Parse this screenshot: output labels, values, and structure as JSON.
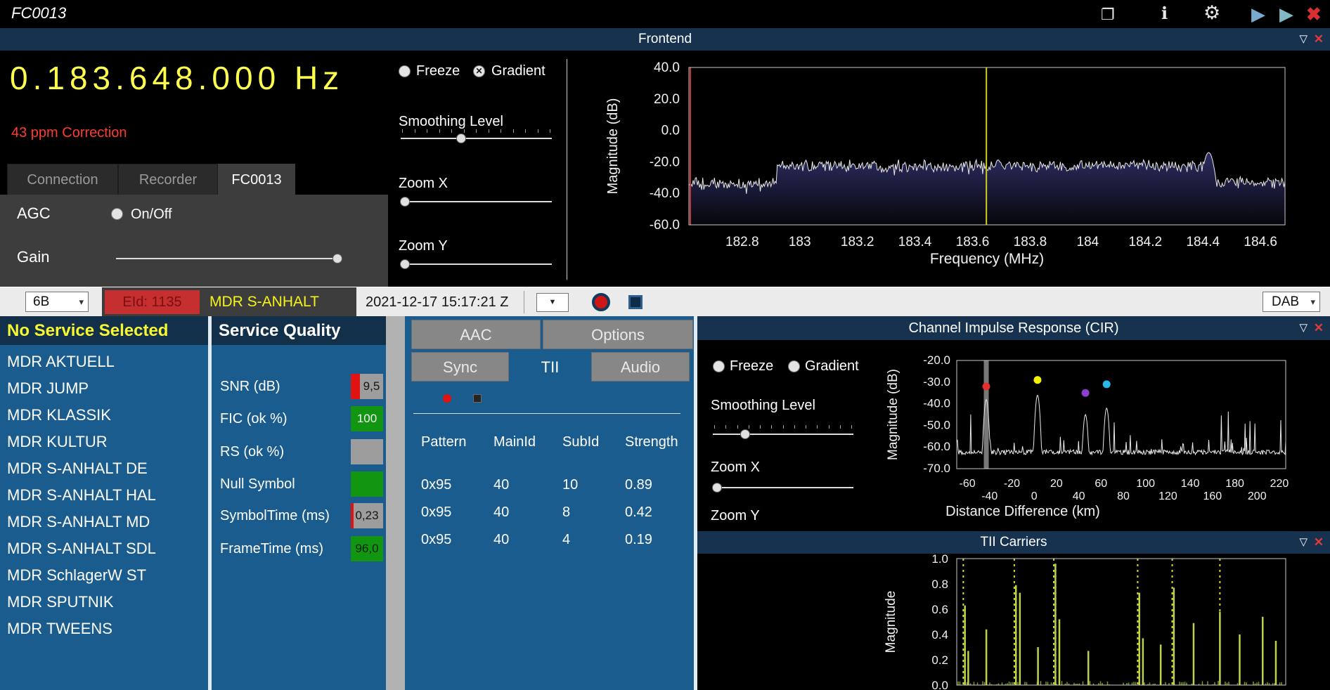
{
  "icons": {
    "window": "❐",
    "info": "ℹ",
    "settings": "⚙",
    "play": "▶",
    "close": "✖",
    "collapse": "▽",
    "panel_close": "✕",
    "dropdown": "▼",
    "select_arrow": "▾"
  },
  "titlebar": {
    "title": "FC0013"
  },
  "frontend": {
    "title": "Frontend",
    "frequency": "0.183.648.000 Hz",
    "correction": "43 ppm Correction",
    "tabs": [
      {
        "label": "Connection",
        "active": false
      },
      {
        "label": "Recorder",
        "active": false
      },
      {
        "label": "FC0013",
        "active": true
      }
    ],
    "agc_label": "AGC",
    "agc_toggle_label": "On/Off",
    "gain_label": "Gain",
    "freeze_label": "Freeze",
    "gradient_label": "Gradient",
    "smoothing_label": "Smoothing Level",
    "zoom_x_label": "Zoom X",
    "zoom_y_label": "Zoom Y"
  },
  "toolbar": {
    "channel": "6B",
    "eid": "EId: 1135",
    "ensemble": "MDR S-ANHALT",
    "timestamp": "2021-12-17  15:17:21 Z",
    "mode": "DAB"
  },
  "services": {
    "header": "No Service Selected",
    "items": [
      "MDR AKTUELL",
      "MDR JUMP",
      "MDR KLASSIK",
      "MDR KULTUR",
      "MDR S-ANHALT DE",
      "MDR S-ANHALT HAL",
      "MDR S-ANHALT MD",
      "MDR S-ANHALT SDL",
      "MDR SchlagerW ST",
      "MDR SPUTNIK",
      "MDR TWEENS"
    ]
  },
  "service_quality": {
    "title": "Service Quality",
    "rows": [
      {
        "label": "SNR (dB)",
        "value": "9,5",
        "box": "gray-redbar"
      },
      {
        "label": "FIC (ok %)",
        "value": "100",
        "box": "green"
      },
      {
        "label": "RS (ok %)",
        "value": "",
        "box": "gray"
      },
      {
        "label": "Null Symbol",
        "value": "",
        "box": "green"
      },
      {
        "label": "SymbolTime (ms)",
        "value": "0,23",
        "box": "gray-redsliver"
      },
      {
        "label": "FrameTime (ms)",
        "value": "96,0",
        "box": "green-dark"
      }
    ]
  },
  "details": {
    "tabs_top": [
      {
        "label": "AAC",
        "active": false
      },
      {
        "label": "Options",
        "active": false
      }
    ],
    "tabs_bottom": [
      {
        "label": "Sync",
        "active": false
      },
      {
        "label": "TII",
        "active": true
      },
      {
        "label": "Audio",
        "active": false
      }
    ],
    "tii_table": {
      "headers": [
        "Pattern",
        "MainId",
        "SubId",
        "Strength"
      ],
      "rows": [
        [
          "0x95",
          "40",
          "10",
          "0.89"
        ],
        [
          "0x95",
          "40",
          "8",
          "0.42"
        ],
        [
          "0x95",
          "40",
          "4",
          "0.19"
        ]
      ]
    }
  },
  "cir": {
    "title": "Channel Impulse Response (CIR)",
    "freeze_label": "Freeze",
    "gradient_label": "Gradient",
    "smoothing_label": "Smoothing Level",
    "zoom_x_label": "Zoom X",
    "zoom_y_label": "Zoom Y"
  },
  "tii_panel": {
    "title": "TII Carriers"
  },
  "colors": {
    "panel_blue": "#1b5c8e",
    "header_navy": "#16324e",
    "list_header_navy": "#12304a",
    "frequency_yellow": "#ffff4d",
    "warning_red": "#ff3b2d",
    "eid_red": "#c62f2f",
    "status_green": "#129612",
    "status_gray": "#9d9d9d",
    "status_red": "#e01212"
  },
  "chart_data": [
    {
      "id": "spectrum",
      "type": "line",
      "xlabel": "Frequency (MHz)",
      "ylabel": "Magnitude (dB)",
      "xlim": [
        182.615,
        184.685
      ],
      "ylim": [
        -60,
        40
      ],
      "xticks": [
        "182.8",
        "183",
        "183.2",
        "183.4",
        "183.6",
        "183.8",
        "184",
        "184.2",
        "184.4",
        "184.6"
      ],
      "yticks": [
        "40.0",
        "20.0",
        "0.0",
        "-20.0",
        "-40.0",
        "-60.0"
      ],
      "cursor_x": 183.648,
      "cursor_color": "#cfcf20",
      "edge_marker_color": "#c03434",
      "trace_color": "#e9e9e9",
      "envelope": [
        {
          "from": 182.615,
          "to": 182.92,
          "level": -34,
          "noise": 2.2
        },
        {
          "from": 182.92,
          "to": 184.44,
          "level": -22.5,
          "noise": 2.2
        },
        {
          "from": 184.44,
          "to": 184.69,
          "level": -33,
          "noise": 2.2
        }
      ],
      "spurs": [
        {
          "x": 184.42,
          "level": -14
        }
      ]
    },
    {
      "id": "cir",
      "type": "line",
      "xlabel": "Distance Difference (km)",
      "ylabel": "Magnitude (dB)",
      "xlim": [
        -69.5,
        225.7
      ],
      "ylim": [
        -70,
        -20
      ],
      "xticks": [
        -60,
        -40,
        -20,
        0,
        20,
        40,
        60,
        80,
        100,
        120,
        140,
        160,
        180,
        200,
        220
      ],
      "yticks": [
        "-20.0",
        "-30.0",
        "-40.0",
        "-50.0",
        "-60.0",
        "-70.0"
      ],
      "floor": -63.5,
      "trace_color": "#e9e9e9",
      "selection_band_x": -43,
      "peaks": [
        {
          "x": -43,
          "level": -38,
          "marker_color": "#e03030",
          "marker_y": -32
        },
        {
          "x": 3,
          "level": -36,
          "marker_color": "#f2f200",
          "marker_y": -29
        },
        {
          "x": 46,
          "level": -45,
          "marker_color": "#8a3fd0",
          "marker_y": -35
        },
        {
          "x": 65,
          "level": -42,
          "marker_color": "#2bb7e8",
          "marker_y": -31
        }
      ]
    },
    {
      "id": "tii",
      "type": "bar",
      "ylabel": "Magnitude",
      "ylim": [
        0,
        1
      ],
      "yticks": [
        "1.0",
        "0.8",
        "0.6",
        "0.4",
        "0.2",
        "0.0"
      ],
      "bar_color": "#bdd14b",
      "guide_color": "#d9d926",
      "guides_x": [
        0.02,
        0.175,
        0.295,
        0.55,
        0.655,
        0.8
      ],
      "spikes": [
        {
          "x": 0.025,
          "h": 0.63
        },
        {
          "x": 0.035,
          "h": 0.27
        },
        {
          "x": 0.09,
          "h": 0.44
        },
        {
          "x": 0.18,
          "h": 0.79
        },
        {
          "x": 0.192,
          "h": 0.73
        },
        {
          "x": 0.247,
          "h": 0.3
        },
        {
          "x": 0.3,
          "h": 0.96
        },
        {
          "x": 0.312,
          "h": 0.52
        },
        {
          "x": 0.4,
          "h": 0.27
        },
        {
          "x": 0.555,
          "h": 0.73
        },
        {
          "x": 0.566,
          "h": 0.37
        },
        {
          "x": 0.62,
          "h": 0.32
        },
        {
          "x": 0.66,
          "h": 0.77
        },
        {
          "x": 0.72,
          "h": 0.49
        },
        {
          "x": 0.8,
          "h": 0.58
        },
        {
          "x": 0.86,
          "h": 0.4
        },
        {
          "x": 0.93,
          "h": 0.54
        },
        {
          "x": 0.97,
          "h": 0.35
        }
      ]
    }
  ]
}
